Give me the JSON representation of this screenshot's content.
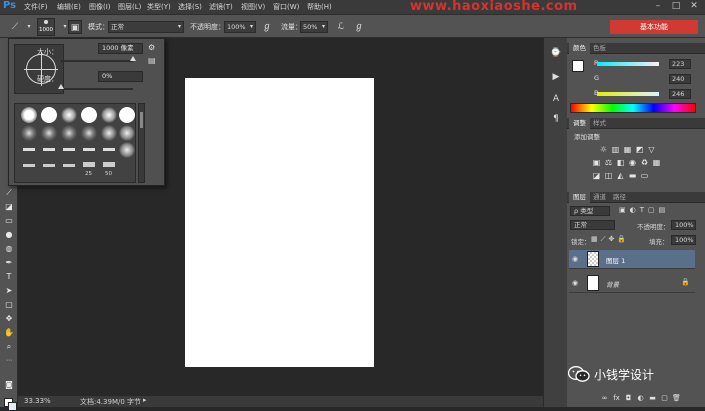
{
  "app": {
    "logo": "Ps"
  },
  "menu": {
    "items": [
      "文件(F)",
      "编辑(E)",
      "图像(I)",
      "图层(L)",
      "类型(Y)",
      "选择(S)",
      "滤镜(T)",
      "视图(V)",
      "窗口(W)",
      "帮助(H)"
    ]
  },
  "watermark": "www.haoxiaoshe.com",
  "options_bar": {
    "brush_size": "1000",
    "mode_label": "模式：",
    "mode_value": "正常",
    "opacity_label": "不透明度：",
    "opacity_value": "100%",
    "flow_label": "流量：",
    "flow_value": "50%",
    "workspace": "基本功能"
  },
  "brush_popup": {
    "size_label": "大小：",
    "size_value": "1000 像素",
    "hardness_label": "硬度：",
    "hardness_value": "0%",
    "size_slider": 1.0,
    "hardness_slider": 0.0,
    "preset_labels": [
      "25",
      "50"
    ]
  },
  "color_panel": {
    "tabs": [
      "颜色",
      "色板"
    ],
    "r": "223",
    "g": "240",
    "b": "246",
    "foreground": "#ffffff",
    "background": "#dff0f6"
  },
  "adjustments_panel": {
    "tabs": [
      "调整",
      "样式"
    ],
    "title": "添加调整"
  },
  "layers_panel": {
    "tabs": [
      "图层",
      "通道",
      "路径"
    ],
    "filter_label": "ρ 类型",
    "blend_mode": "正常",
    "opacity_label": "不透明度：",
    "opacity_value": "100%",
    "lock_label": "锁定：",
    "fill_label": "填充：",
    "fill_value": "100%",
    "layers": [
      {
        "name": "图层 1",
        "selected": true
      },
      {
        "name": "背景",
        "selected": false
      }
    ]
  },
  "status_bar": {
    "zoom": "33.33%",
    "doc_info": "文档:4.39M/0 字节"
  },
  "social": {
    "account": "小钱学设计"
  },
  "colors": {
    "accent_red": "#d03a32",
    "ps_blue": "#3d8de0",
    "selected_layer": "#5a6f8a"
  }
}
